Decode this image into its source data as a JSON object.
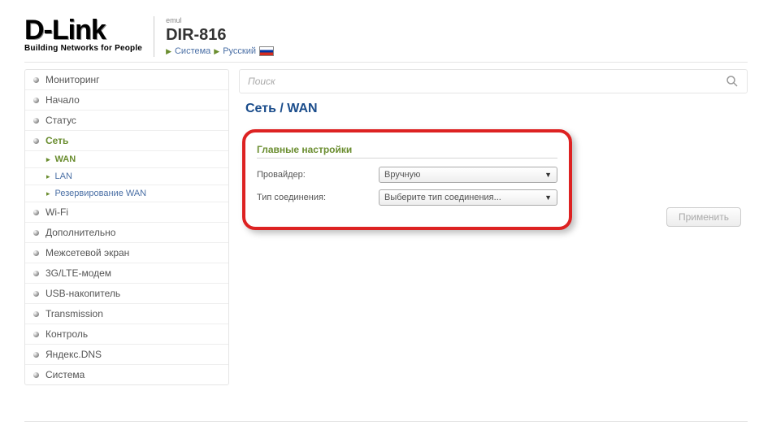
{
  "header": {
    "brand": "D-Link",
    "tagline": "Building Networks for People",
    "tag_small": "emul",
    "model": "DIR-816",
    "crumb1": "Система",
    "crumb2": "Русский"
  },
  "search": {
    "placeholder": "Поиск"
  },
  "sidebar": {
    "items": [
      "Мониторинг",
      "Начало",
      "Статус",
      "Сеть",
      "Wi-Fi",
      "Дополнительно",
      "Межсетевой экран",
      "3G/LTE-модем",
      "USB-накопитель",
      "Transmission",
      "Контроль",
      "Яндекс.DNS",
      "Система"
    ],
    "net_sub": [
      "WAN",
      "LAN",
      "Резервирование WAN"
    ]
  },
  "main": {
    "title": "Сеть /  WAN",
    "section": "Главные настройки",
    "provider_label": "Провайдер:",
    "provider_value": "Вручную",
    "conn_label": "Тип соединения:",
    "conn_value": "Выберите тип соединения...",
    "apply": "Применить"
  }
}
